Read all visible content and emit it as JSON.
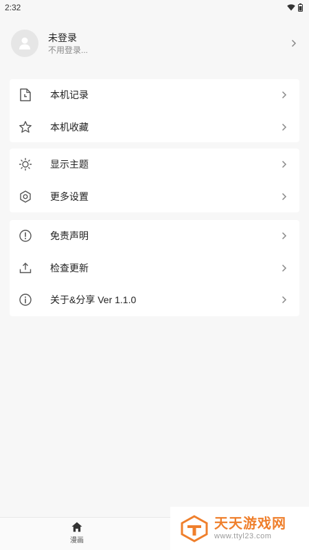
{
  "status_bar": {
    "time": "2:32"
  },
  "profile": {
    "name": "未登录",
    "subtitle": "不用登录..."
  },
  "menu_groups": [
    {
      "items": [
        {
          "label": "本机记录",
          "icon": "history-file-icon"
        },
        {
          "label": "本机收藏",
          "icon": "star-icon"
        }
      ]
    },
    {
      "items": [
        {
          "label": "显示主题",
          "icon": "sun-icon"
        },
        {
          "label": "更多设置",
          "icon": "settings-hexagon-icon"
        }
      ]
    },
    {
      "items": [
        {
          "label": "免责声明",
          "icon": "alert-circle-icon"
        },
        {
          "label": "检查更新",
          "icon": "upload-icon"
        },
        {
          "label": "关于&分享 Ver 1.1.0",
          "icon": "info-icon"
        }
      ]
    }
  ],
  "bottom_nav": {
    "home_label": "漫画"
  },
  "watermark": {
    "title": "天天游戏网",
    "url": "www.ttyl23.com",
    "color": "#ef7f2c"
  }
}
